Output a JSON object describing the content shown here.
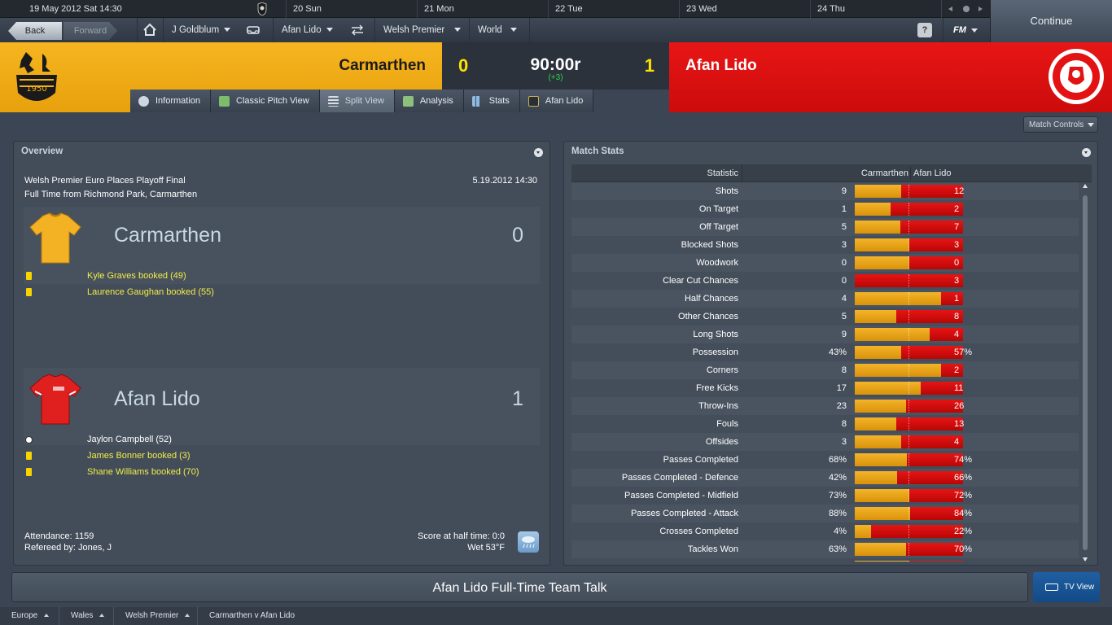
{
  "topbar": {
    "current_date": "19 May 2012  Sat  14:30",
    "days": [
      "20  Sun",
      "21  Mon",
      "22  Tue",
      "23  Wed",
      "24  Thu"
    ],
    "back_label": "Back",
    "forward_label": "Forward",
    "manager": "J Goldblum",
    "club": "Afan Lido",
    "league": "Welsh Premier",
    "world": "World",
    "help_label": "?",
    "fm_label": "FM",
    "continue_label": "Continue"
  },
  "match": {
    "home_team": "Carmarthen",
    "away_team": "Afan Lido",
    "home_score": "0",
    "away_score": "1",
    "clock": "90:00r",
    "added_time": "(+3)",
    "colors": {
      "home": "#f3b01a",
      "away": "#e31313"
    }
  },
  "tabs": [
    {
      "label": "Information",
      "icon": "info-icon"
    },
    {
      "label": "Classic Pitch View",
      "icon": "pitch-icon"
    },
    {
      "label": "Split View",
      "icon": "split-icon"
    },
    {
      "label": "Analysis",
      "icon": "analysis-icon"
    },
    {
      "label": "Stats",
      "icon": "stats-icon"
    },
    {
      "label": "Afan Lido",
      "icon": "club-icon"
    }
  ],
  "match_controls_label": "Match Controls",
  "overview": {
    "title": "Overview",
    "competition": "Welsh Premier Euro Places Playoff Final",
    "venue": "Full Time from Richmond Park, Carmarthen",
    "date": "5.19.2012 14:30",
    "home": {
      "name": "Carmarthen",
      "score": "0",
      "events": [
        {
          "text": "Kyle Graves booked (49)",
          "type": "yellow-card"
        },
        {
          "text": "Laurence Gaughan booked (55)",
          "type": "yellow-card"
        }
      ]
    },
    "away": {
      "name": "Afan Lido",
      "score": "1",
      "events": [
        {
          "text": "Jaylon Campbell (52)",
          "type": "goal"
        },
        {
          "text": "James Bonner booked (3)",
          "type": "yellow-card"
        },
        {
          "text": "Shane Williams booked (70)",
          "type": "yellow-card"
        }
      ]
    },
    "attendance": "Attendance: 1159",
    "referee": "Refereed by: Jones, J",
    "halftime": "Score at half time: 0:0",
    "weather": "Wet 53°F"
  },
  "stats": {
    "title": "Match Stats",
    "columns": {
      "statistic": "Statistic",
      "home": "Carmarthen",
      "away": "Afan Lido"
    },
    "rows": [
      {
        "label": "Shots",
        "home": "9",
        "away": "12",
        "home_share": 0.43
      },
      {
        "label": "On Target",
        "home": "1",
        "away": "2",
        "home_share": 0.33
      },
      {
        "label": "Off Target",
        "home": "5",
        "away": "7",
        "home_share": 0.42
      },
      {
        "label": "Blocked Shots",
        "home": "3",
        "away": "3",
        "home_share": 0.5
      },
      {
        "label": "Woodwork",
        "home": "0",
        "away": "0",
        "home_share": 0.5
      },
      {
        "label": "Clear Cut Chances",
        "home": "0",
        "away": "3",
        "home_share": 0.0
      },
      {
        "label": "Half Chances",
        "home": "4",
        "away": "1",
        "home_share": 0.8
      },
      {
        "label": "Other Chances",
        "home": "5",
        "away": "8",
        "home_share": 0.38
      },
      {
        "label": "Long Shots",
        "home": "9",
        "away": "4",
        "home_share": 0.69
      },
      {
        "label": "Possession",
        "home": "43%",
        "away": "57%",
        "home_share": 0.43
      },
      {
        "label": "Corners",
        "home": "8",
        "away": "2",
        "home_share": 0.8
      },
      {
        "label": "Free Kicks",
        "home": "17",
        "away": "11",
        "home_share": 0.61
      },
      {
        "label": "Throw-Ins",
        "home": "23",
        "away": "26",
        "home_share": 0.47
      },
      {
        "label": "Fouls",
        "home": "8",
        "away": "13",
        "home_share": 0.38
      },
      {
        "label": "Offsides",
        "home": "3",
        "away": "4",
        "home_share": 0.43
      },
      {
        "label": "Passes Completed",
        "home": "68%",
        "away": "74%",
        "home_share": 0.48
      },
      {
        "label": "Passes Completed - Defence",
        "home": "42%",
        "away": "66%",
        "home_share": 0.39
      },
      {
        "label": "Passes Completed - Midfield",
        "home": "73%",
        "away": "72%",
        "home_share": 0.5
      },
      {
        "label": "Passes Completed - Attack",
        "home": "88%",
        "away": "84%",
        "home_share": 0.51
      },
      {
        "label": "Crosses Completed",
        "home": "4%",
        "away": "22%",
        "home_share": 0.15
      },
      {
        "label": "Tackles Won",
        "home": "63%",
        "away": "70%",
        "home_share": 0.47
      },
      {
        "label": "",
        "home": "",
        "away": "",
        "home_share": 0.5
      }
    ]
  },
  "bottom": {
    "team_talk": "Afan Lido Full-Time Team Talk",
    "tv_view": "TV View"
  },
  "statusbar": {
    "crumbs": [
      "Europe",
      "Wales",
      "Welsh Premier",
      "Carmarthen v Afan Lido"
    ]
  }
}
